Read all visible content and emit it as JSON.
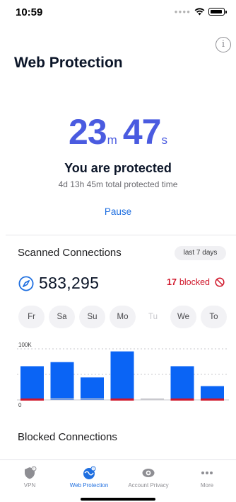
{
  "status": {
    "time": "10:59"
  },
  "header": {
    "title": "Web Protection",
    "info_icon": "info-icon"
  },
  "timer": {
    "minutes": "23",
    "minutes_unit": "m",
    "seconds": "47",
    "seconds_unit": "s"
  },
  "protection": {
    "title": "You are protected",
    "subtitle": "4d 13h 45m total protected time",
    "pause_label": "Pause"
  },
  "scanned": {
    "title": "Scanned Connections",
    "range_label": "last 7 days",
    "count": "583,295",
    "blocked_count": "17",
    "blocked_label": "blocked",
    "days": [
      {
        "label": "Fr",
        "enabled": true
      },
      {
        "label": "Sa",
        "enabled": true
      },
      {
        "label": "Su",
        "enabled": true
      },
      {
        "label": "Mo",
        "enabled": true
      },
      {
        "label": "Tu",
        "enabled": false
      },
      {
        "label": "We",
        "enabled": true
      },
      {
        "label": "To",
        "enabled": true
      }
    ]
  },
  "chart_data": {
    "type": "bar",
    "categories": [
      "Fr",
      "Sa",
      "Su",
      "Mo",
      "Tu",
      "We",
      "To"
    ],
    "ytick_labels": [
      "100K",
      "0"
    ],
    "ylim": [
      0,
      100000
    ],
    "series": [
      {
        "values": [
          66000,
          74000,
          44000,
          95000,
          0,
          66000,
          27000
        ]
      },
      {
        "values": [
          3,
          0,
          0,
          4,
          0,
          4,
          6
        ]
      }
    ],
    "colors": {
      "scanned": "#0a64f5",
      "blocked": "#d0172b",
      "grid": "#c9c9ce"
    }
  },
  "blocked_section": {
    "title": "Blocked Connections"
  },
  "tabs": [
    {
      "label": "VPN",
      "icon": "vpn-shield-icon",
      "active": false
    },
    {
      "label": "Web Protection",
      "icon": "web-protection-icon",
      "active": true
    },
    {
      "label": "Account Privacy",
      "icon": "eye-icon",
      "active": false
    },
    {
      "label": "More",
      "icon": "more-icon",
      "active": false
    }
  ],
  "colors": {
    "accent": "#1f6fe0",
    "timer": "#4a5be0",
    "danger": "#d0172b"
  }
}
